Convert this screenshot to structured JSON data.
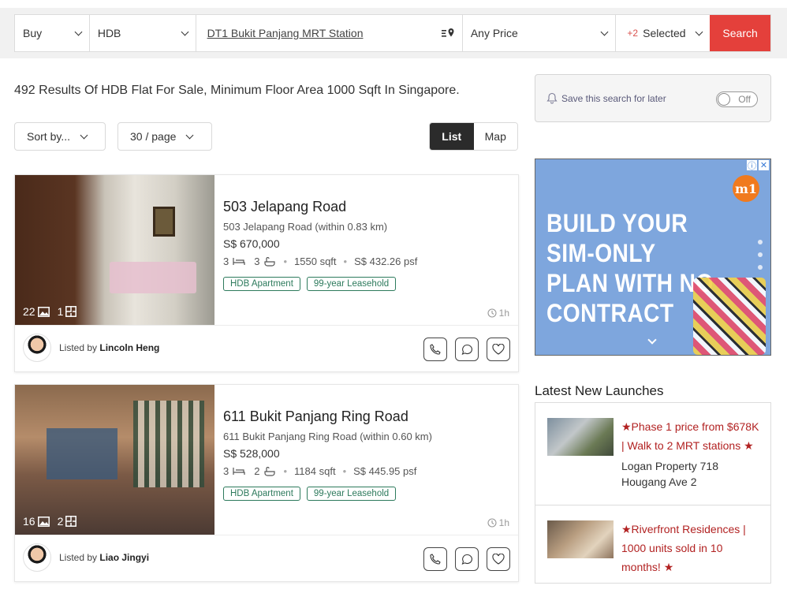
{
  "search": {
    "mode": "Buy",
    "property_type": "HDB",
    "location": "DT1 Bukit Panjang MRT Station",
    "price": "Any Price",
    "extra_count": "+2",
    "extra_label": "Selected",
    "search_label": "Search"
  },
  "results": {
    "title": "492 Results Of HDB Flat For Sale, Minimum Floor Area 1000 Sqft In Singapore.",
    "sort_label": "Sort by...",
    "per_page_label": "30 / page",
    "view_list": "List",
    "view_map": "Map"
  },
  "listings": [
    {
      "name": "503 Jelapang Road",
      "address": "503 Jelapang Road (within 0.83 km)",
      "price": "S$ 670,000",
      "beds": "3",
      "baths": "3",
      "area": "1550 sqft",
      "psf": "S$ 432.26 psf",
      "tags": [
        "HDB Apartment",
        "99-year Leasehold"
      ],
      "photos": "22",
      "floorplans": "1",
      "time": "1h",
      "listed_by_prefix": "Listed by",
      "agent": "Lincoln Heng"
    },
    {
      "name": "611 Bukit Panjang Ring Road",
      "address": "611 Bukit Panjang Ring Road (within 0.60 km)",
      "price": "S$ 528,000",
      "beds": "3",
      "baths": "2",
      "area": "1184 sqft",
      "psf": "S$ 445.95 psf",
      "tags": [
        "HDB Apartment",
        "99-year Leasehold"
      ],
      "photos": "16",
      "floorplans": "2",
      "time": "1h",
      "listed_by_prefix": "Listed by",
      "agent": "Liao Jingyi"
    }
  ],
  "sidebar": {
    "save_search": "Save this search for later",
    "toggle_state": "Off",
    "ad_headline": "BUILD YOUR SIM-ONLY PLAN WITH NO CONTRACT",
    "ad_logo": "m1",
    "launches_title": "Latest New Launches",
    "launches": [
      {
        "promo": "★Phase 1 price from $678K | Walk to 2 MRT stations ★",
        "project": "Logan Property 718 Hougang Ave 2"
      },
      {
        "promo": "★Riverfront Residences | 1000 units sold in 10 months! ★",
        "project": ""
      }
    ]
  },
  "colors": {
    "accent": "#e4403b",
    "tag": "#2d7a5c",
    "promo": "#b22222"
  }
}
